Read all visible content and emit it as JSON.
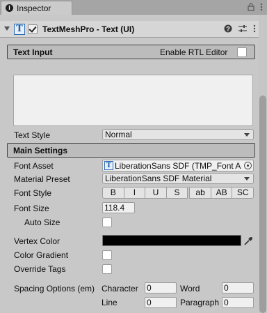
{
  "tab": {
    "icon": "info-icon",
    "label": "Inspector"
  },
  "tabbar_icons": [
    "lock-icon",
    "kebab-menu-icon"
  ],
  "component": {
    "icon": "textmeshpro-icon",
    "icon_glyph": "T",
    "enabled": true,
    "title": "TextMeshPro - Text (UI)",
    "tools": [
      "help-icon",
      "preset-sliders-icon",
      "context-menu-icon"
    ]
  },
  "text_input": {
    "title": "Text Input",
    "rtl_label": "Enable RTL Editor",
    "rtl_enabled": false,
    "text_value": ""
  },
  "text_style": {
    "label": "Text Style",
    "value": "Normal"
  },
  "main_settings": {
    "title": "Main Settings",
    "font_asset": {
      "label": "Font Asset",
      "icon_glyph": "T",
      "value": "LiberationSans SDF (TMP_Font A"
    },
    "material_preset": {
      "label": "Material Preset",
      "value": "LiberationSans SDF Material"
    },
    "font_style": {
      "label": "Font Style",
      "buttons": [
        "B",
        "I",
        "U",
        "S",
        "ab",
        "AB",
        "SC"
      ]
    },
    "font_size": {
      "label": "Font Size",
      "value": "118.4"
    },
    "auto_size": {
      "label": "Auto Size",
      "checked": false
    },
    "vertex_color": {
      "label": "Vertex Color",
      "value": "#000000"
    },
    "color_gradient": {
      "label": "Color Gradient",
      "checked": false
    },
    "override_tags": {
      "label": "Override Tags",
      "checked": false
    },
    "spacing": {
      "label": "Spacing Options (em)",
      "character_label": "Character",
      "character_value": "0",
      "word_label": "Word",
      "word_value": "0",
      "line_label": "Line",
      "line_value": "0",
      "paragraph_label": "Paragraph",
      "paragraph_value": "0"
    }
  }
}
